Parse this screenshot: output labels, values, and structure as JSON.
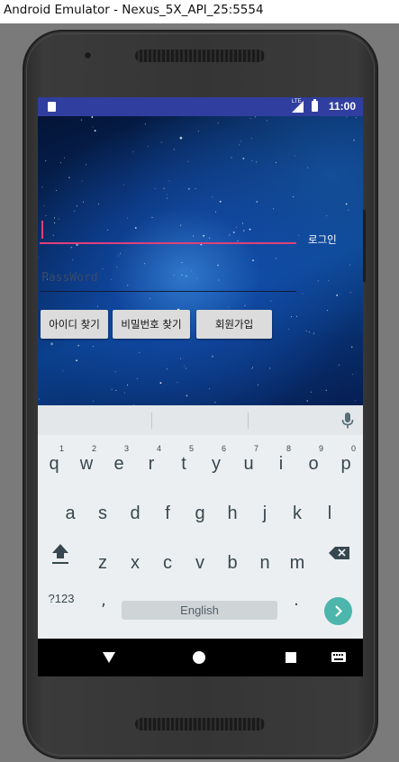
{
  "window": {
    "title": "Android Emulator - Nexus_5X_API_25:5554"
  },
  "status_bar": {
    "time": "11:00",
    "network_label": "LTE"
  },
  "app": {
    "id_field": {
      "value": "",
      "placeholder": ""
    },
    "login_label": "로그인",
    "password_field": {
      "value": "",
      "placeholder": "PassWord"
    },
    "buttons": {
      "find_id": "아이디 찾기",
      "find_password": "비밀번호 찾기",
      "signup": "회원가입"
    },
    "colors": {
      "accent": "#e0407a",
      "status_bar": "#303e9f"
    }
  },
  "keyboard": {
    "row1": [
      {
        "key": "q",
        "hint": "1"
      },
      {
        "key": "w",
        "hint": "2"
      },
      {
        "key": "e",
        "hint": "3"
      },
      {
        "key": "r",
        "hint": "4"
      },
      {
        "key": "t",
        "hint": "5"
      },
      {
        "key": "y",
        "hint": "6"
      },
      {
        "key": "u",
        "hint": "7"
      },
      {
        "key": "i",
        "hint": "8"
      },
      {
        "key": "o",
        "hint": "9"
      },
      {
        "key": "p",
        "hint": "0"
      }
    ],
    "row2": [
      "a",
      "s",
      "d",
      "f",
      "g",
      "h",
      "j",
      "k",
      "l"
    ],
    "row3": [
      "z",
      "x",
      "c",
      "v",
      "b",
      "n",
      "m"
    ],
    "symbols_key": "?123",
    "comma_key": ",",
    "space_key": "English",
    "period_key": ".",
    "icons": {
      "shift": "shift-icon",
      "backspace": "backspace-icon",
      "enter": "enter-arrow-icon",
      "mic": "mic-icon"
    },
    "enter_color": "#4db6ac"
  },
  "nav_bar": {
    "icons": [
      "back-icon",
      "home-icon",
      "recents-icon",
      "keyboard-switch-icon"
    ]
  }
}
